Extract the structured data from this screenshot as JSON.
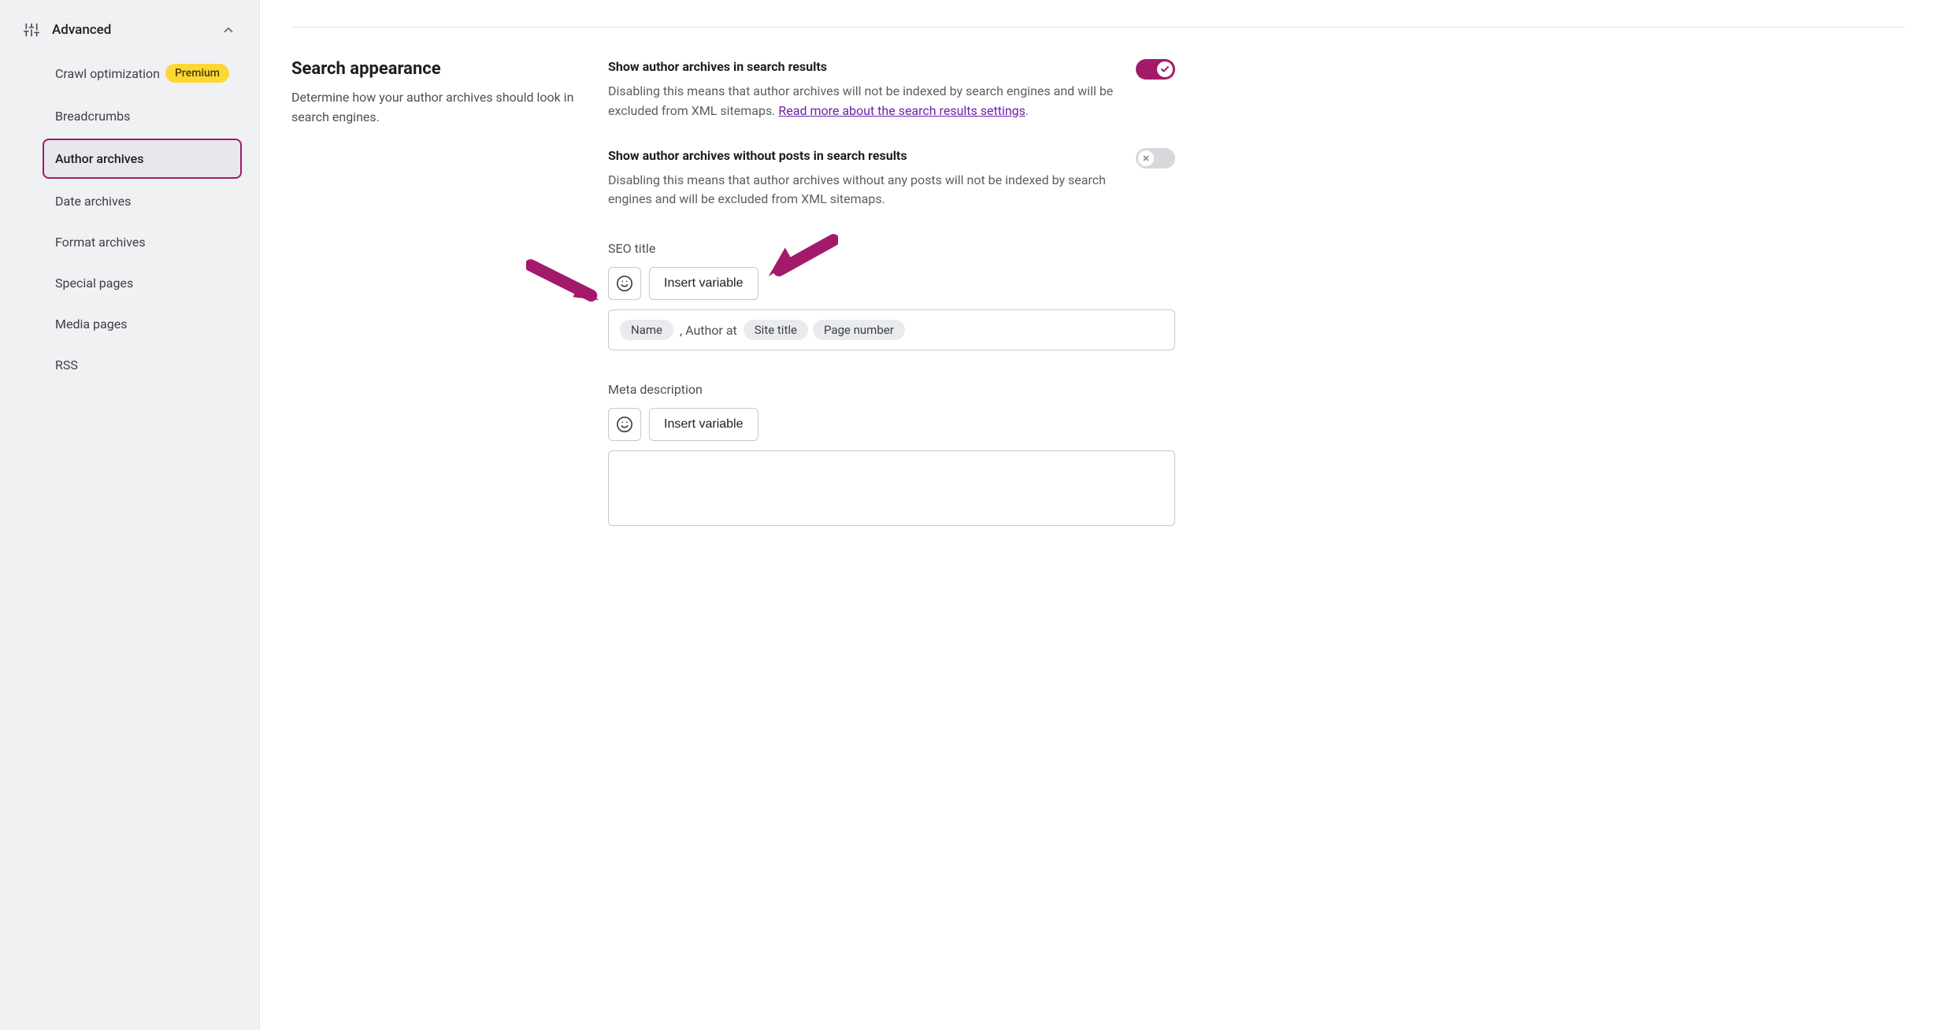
{
  "sidebar": {
    "header": {
      "title": "Advanced"
    },
    "items": [
      {
        "label": "Crawl optimization",
        "badge": "Premium",
        "active": false
      },
      {
        "label": "Breadcrumbs",
        "active": false
      },
      {
        "label": "Author archives",
        "active": true
      },
      {
        "label": "Date archives",
        "active": false
      },
      {
        "label": "Format archives",
        "active": false
      },
      {
        "label": "Special pages",
        "active": false
      },
      {
        "label": "Media pages",
        "active": false
      },
      {
        "label": "RSS",
        "active": false
      }
    ]
  },
  "section": {
    "title": "Search appearance",
    "desc": "Determine how your author archives should look in search engines."
  },
  "settings": {
    "show_in_results": {
      "title": "Show author archives in search results",
      "desc_pre": "Disabling this means that author archives will not be indexed by search engines and will be excluded from XML sitemaps. ",
      "link": "Read more about the search results settings",
      "desc_post": ".",
      "on": true
    },
    "show_without_posts": {
      "title": "Show author archives without posts in search results",
      "desc": "Disabling this means that author archives without any posts will not be indexed by search engines and will be excluded from XML sitemaps.",
      "on": false
    }
  },
  "seo_title": {
    "label": "SEO title",
    "insert_label": "Insert variable",
    "tokens": [
      {
        "type": "token",
        "text": "Name"
      },
      {
        "type": "text",
        "text": ", Author at"
      },
      {
        "type": "token",
        "text": "Site title"
      },
      {
        "type": "token",
        "text": "Page number"
      }
    ]
  },
  "meta_desc": {
    "label": "Meta description",
    "insert_label": "Insert variable"
  }
}
